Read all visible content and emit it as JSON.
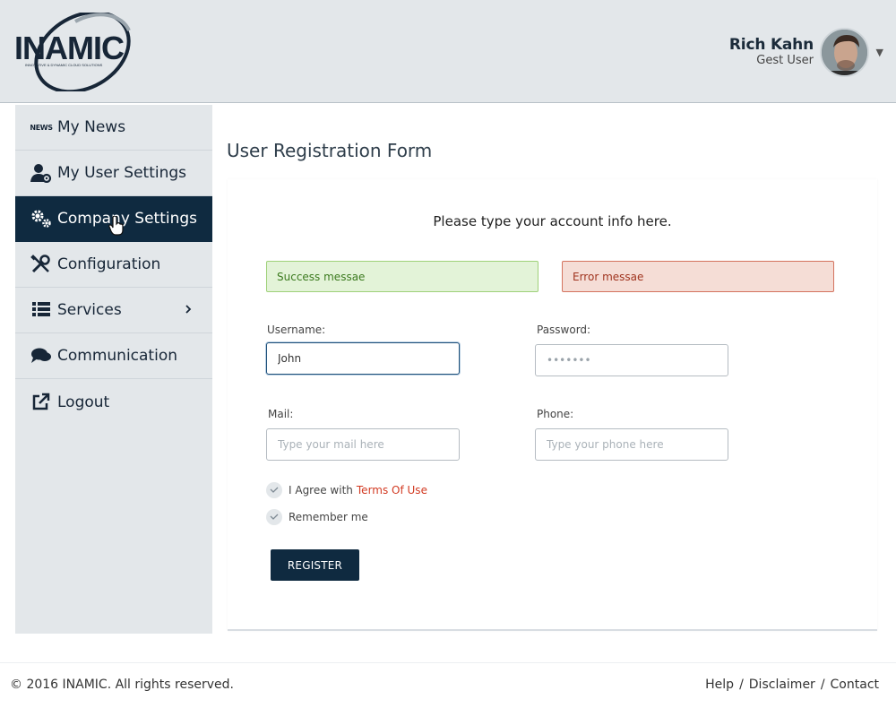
{
  "brand": {
    "logo_text": "INAMIC",
    "logo_tagline": "INNOVATIVE & DYNAMIC CLOUD SOLUTIONS"
  },
  "user": {
    "name": "Rich Kahn",
    "role": "Gest User"
  },
  "sidebar": {
    "items": [
      {
        "label": "My News",
        "icon": "news-icon"
      },
      {
        "label": "My User Settings",
        "icon": "user-settings-icon"
      },
      {
        "label": "Company Settings",
        "icon": "gears-icon",
        "active": true
      },
      {
        "label": "Configuration",
        "icon": "tools-icon"
      },
      {
        "label": "Services",
        "icon": "list-icon",
        "has_submenu": true
      },
      {
        "label": "Communication",
        "icon": "chat-bubbles-icon"
      },
      {
        "label": "Logout",
        "icon": "external-link-icon"
      }
    ],
    "news_icon_text": "NEWS"
  },
  "page": {
    "title": "User Registration Form"
  },
  "form": {
    "intro": "Please type your account info here.",
    "success_message": "Success messae",
    "error_message": "Error messae",
    "username": {
      "label": "Username:",
      "value": "John"
    },
    "password": {
      "label": "Password:",
      "value": "•••••••"
    },
    "mail": {
      "label": "Mail:",
      "placeholder": "Type your mail here"
    },
    "phone": {
      "label": "Phone:",
      "placeholder": "Type your phone here"
    },
    "agree": {
      "text": "I Agree with",
      "link": "Terms Of Use"
    },
    "remember": {
      "text": "Remember me"
    },
    "submit_label": "REGISTER"
  },
  "footer": {
    "copyright": "© 2016 INAMIC. All rights reserved.",
    "links": [
      "Help",
      "Disclaimer",
      "Contact"
    ],
    "separator": "/"
  },
  "colors": {
    "primary": "#0f2a40",
    "panel": "#e3e7ea",
    "success": "#e3f3d8",
    "error": "#f5ddd6",
    "link": "#d23a22"
  }
}
